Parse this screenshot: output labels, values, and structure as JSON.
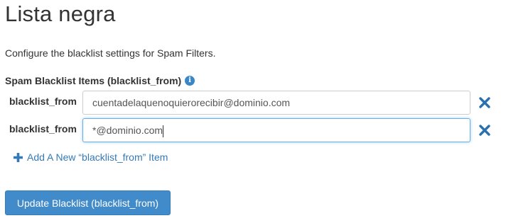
{
  "page": {
    "title": "Lista negra",
    "description": "Configure the blacklist settings for Spam Filters."
  },
  "section": {
    "label": "Spam Blacklist Items (blacklist_from)",
    "info_icon": "info-circle-icon"
  },
  "items": [
    {
      "label": "blacklist_from",
      "value": "cuentadelaquenoquierorecibir@dominio.com",
      "focused": false
    },
    {
      "label": "blacklist_from",
      "value": "*@dominio.com",
      "focused": true
    }
  ],
  "remove_icon": "times-icon",
  "add_link": {
    "icon": "plus-icon",
    "label": "Add A New “blacklist_from” Item"
  },
  "update_button": {
    "label": "Update Blacklist (blacklist_from)"
  },
  "colors": {
    "link": "#337ab7",
    "primary_button": "#428bca",
    "info_icon": "#3a87c8",
    "remove_icon": "#2a6fb0"
  }
}
